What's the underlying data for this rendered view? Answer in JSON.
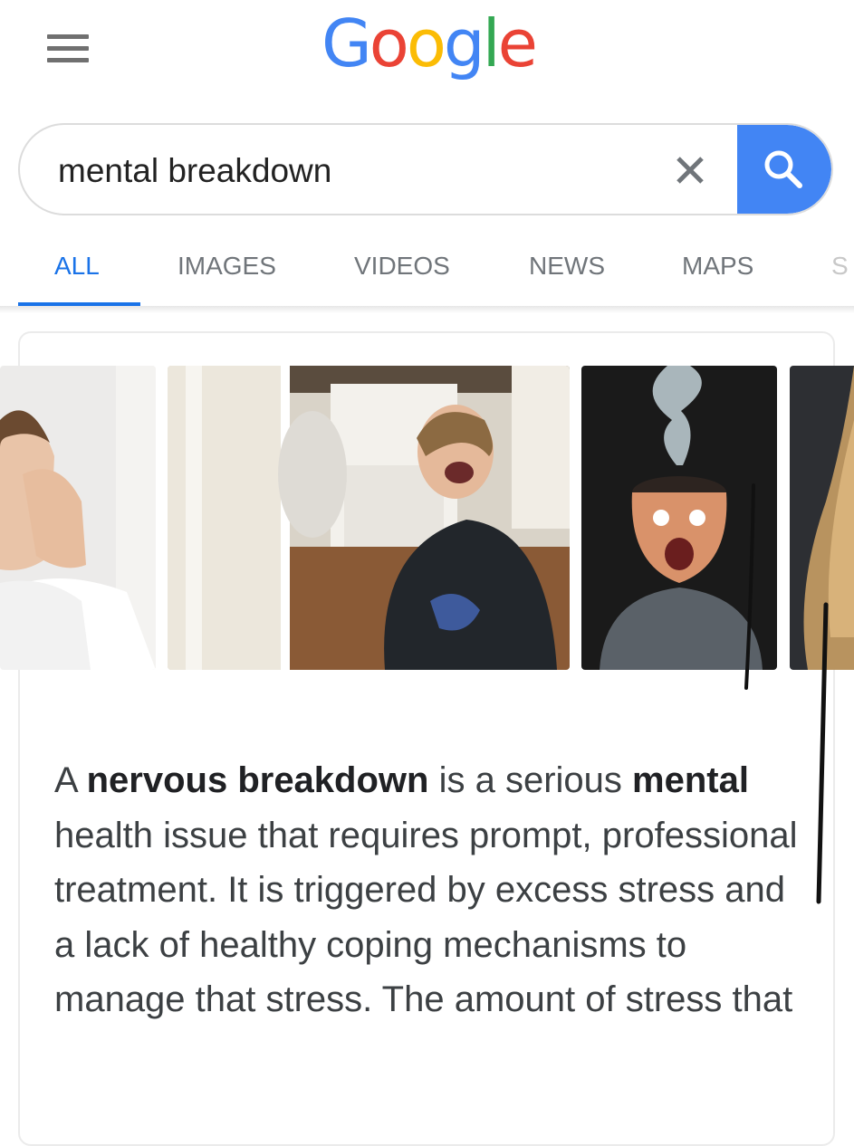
{
  "header": {
    "menu_icon": "hamburger-menu-icon",
    "logo": [
      "G",
      "o",
      "o",
      "g",
      "l",
      "e"
    ]
  },
  "search": {
    "query": "mental breakdown",
    "clear_icon": "close-icon",
    "search_icon": "search-icon",
    "accent_color": "#4285f4"
  },
  "tabs": [
    {
      "label": "ALL",
      "active": true
    },
    {
      "label": "IMAGES",
      "active": false
    },
    {
      "label": "VIDEOS",
      "active": false
    },
    {
      "label": "NEWS",
      "active": false
    },
    {
      "label": "MAPS",
      "active": false
    },
    {
      "label": "S",
      "active": false
    }
  ],
  "result": {
    "snippet": {
      "p1": "A ",
      "b1": "nervous breakdown",
      "p2": " is a serious ",
      "b2": "mental",
      "p3": " health issue that requires prompt, professional treatment. It is triggered by excess stress and a lack of healthy coping mechanisms to manage that stress. The amount of stress that"
    }
  }
}
